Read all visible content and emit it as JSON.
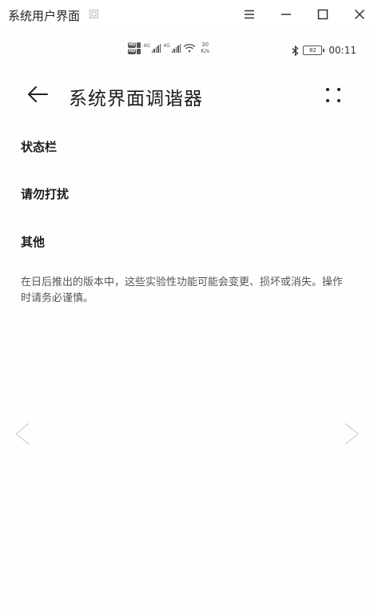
{
  "window": {
    "title": "系统用户界面",
    "controls": [
      "menu",
      "minimize",
      "maximize",
      "close"
    ]
  },
  "statusbar": {
    "net_type_1": "4G",
    "net_type_2": "4G",
    "speed_value": "30",
    "speed_unit": "K/s",
    "battery": "82",
    "time": "00:11"
  },
  "appbar": {
    "title": "系统界面调谐器"
  },
  "items": [
    {
      "label": "状态栏"
    },
    {
      "label": "请勿打扰"
    },
    {
      "label": "其他"
    }
  ],
  "note": "在日后推出的版本中，这些实验性功能可能会变更、损坏或消失。操作时请务必谨慎。",
  "colors": {
    "background": "#fefefe",
    "text": "#1a1a1a",
    "secondary": "#555555",
    "arrow": "#d8d8d8"
  }
}
